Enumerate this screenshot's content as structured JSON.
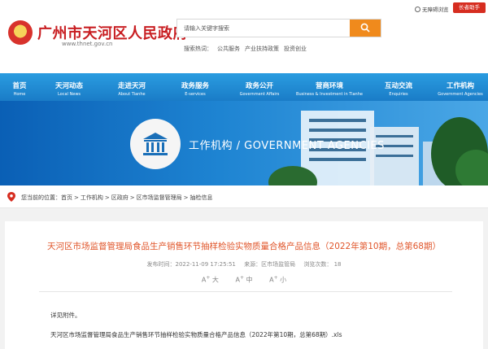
{
  "header": {
    "site_title": "广州市天河区人民政府",
    "site_url": "www.thnet.gov.cn",
    "accessibility_label": "无障碍浏览",
    "elder_mode_label": "长者助手"
  },
  "search": {
    "placeholder": "请输入关键字搜索",
    "hot_label": "搜索热词：",
    "hot_terms": [
      "公共服务",
      "产业扶持政策",
      "投资创业"
    ]
  },
  "nav": {
    "items": [
      {
        "cn": "首页",
        "en": "Home"
      },
      {
        "cn": "天河动态",
        "en": "Local News"
      },
      {
        "cn": "走进天河",
        "en": "About Tianhe"
      },
      {
        "cn": "政务服务",
        "en": "E-services"
      },
      {
        "cn": "政务公开",
        "en": "Government Affairs"
      },
      {
        "cn": "营商环境",
        "en": "Business & Investment in Tianhe"
      },
      {
        "cn": "互动交流",
        "en": "Enquiries"
      },
      {
        "cn": "工作机构",
        "en": "Government Agencies"
      }
    ]
  },
  "banner": {
    "text": "工作机构 / GOVERNMENT AGENCIES"
  },
  "breadcrumb": {
    "prefix": "您当前的位置：",
    "items": [
      "首页",
      "工作机构",
      "区政府",
      "区市场监督管理局",
      "抽检信息"
    ],
    "separator": ">"
  },
  "article": {
    "title": "天河区市场监督管理局食品生产销售环节抽样检验实物质量合格产品信息（2022年第10期，总第68期）",
    "published": "发布时间：2022-11-09 17:25:51",
    "source": "来源：区市场监管局",
    "views": "浏览次数： 18",
    "font_sizes": [
      "大",
      "中",
      "小"
    ],
    "body_intro": "详见附件。",
    "attachment": "天河区市场监督管理局食品生产销售环节抽样检验实物质量合格产品信息（2022年第10期，总第68期）.xls"
  }
}
